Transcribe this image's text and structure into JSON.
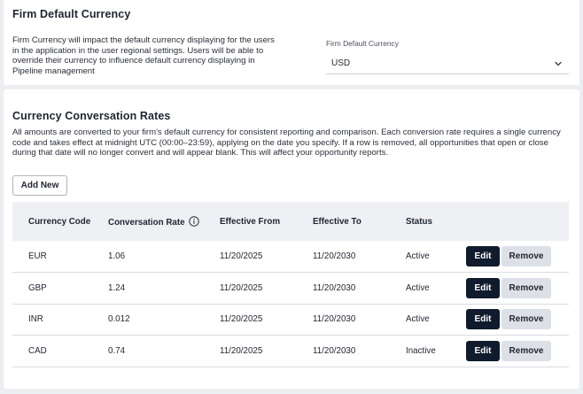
{
  "firm_currency": {
    "title": "Firm Default Currency",
    "description": "Firm Currency will impact the default currency displaying for the users in the application in the user regional settings. Users will be able to override their currency to influence default currency displaying in Pipeline management",
    "select_label": "Firm Default Currency",
    "select_value": "USD",
    "select_icon": "chevron-down-icon"
  },
  "rates": {
    "title": "Currency Conversation Rates",
    "description": "All amounts are converted to your firm's default currency for consistent reporting and comparison. Each conversion rate requires a single currency code and takes effect at midnight UTC (00:00–23:59), applying on the date you specify. If a row is removed, all opportunities that open or close during that date will no longer convert and will appear blank. This will affect your opportunity reports.",
    "add_new_label": "Add New",
    "columns": {
      "code": "Currency Code",
      "rate": "Conversation Rate",
      "from": "Effective From",
      "to": "Effective To",
      "status": "Status"
    },
    "rows": [
      {
        "code": "EUR",
        "rate": "1.06",
        "from": "11/20/2025",
        "to": "11/20/2030",
        "status": "Active"
      },
      {
        "code": "GBP",
        "rate": "1.24",
        "from": "11/20/2025",
        "to": "11/20/2030",
        "status": "Active"
      },
      {
        "code": "INR",
        "rate": "0.012",
        "from": "11/20/2025",
        "to": "11/20/2030",
        "status": "Active"
      },
      {
        "code": "CAD",
        "rate": "0.74",
        "from": "11/20/2025",
        "to": "11/20/2030",
        "status": "Inactive"
      }
    ],
    "edit_label": "Edit",
    "remove_label": "Remove"
  },
  "colors": {
    "page_bg": "#eceef1",
    "header_bg": "#eef0f4",
    "edit_bg": "#101b2d",
    "remove_bg": "#dde1e7"
  }
}
